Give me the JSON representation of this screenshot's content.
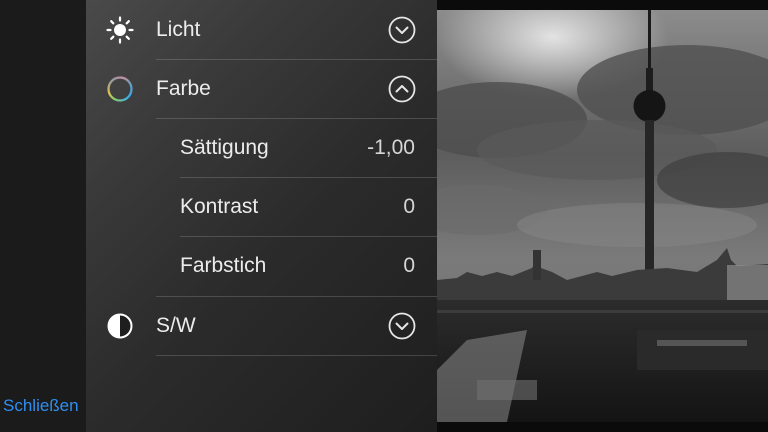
{
  "left": {
    "close_label": "Schließen"
  },
  "panel": {
    "sections": [
      {
        "label": "Licht",
        "icon": "sun-icon",
        "expanded": false
      },
      {
        "label": "Farbe",
        "icon": "color-wheel-icon",
        "expanded": true
      },
      {
        "label": "S/W",
        "icon": "half-circle-icon",
        "expanded": false
      }
    ],
    "color_controls": [
      {
        "label": "Sättigung",
        "value": "-1,00"
      },
      {
        "label": "Kontrast",
        "value": "0"
      },
      {
        "label": "Farbstich",
        "value": "0"
      }
    ]
  },
  "colors": {
    "accent": "#2f8ff0",
    "text": "#ececec"
  }
}
